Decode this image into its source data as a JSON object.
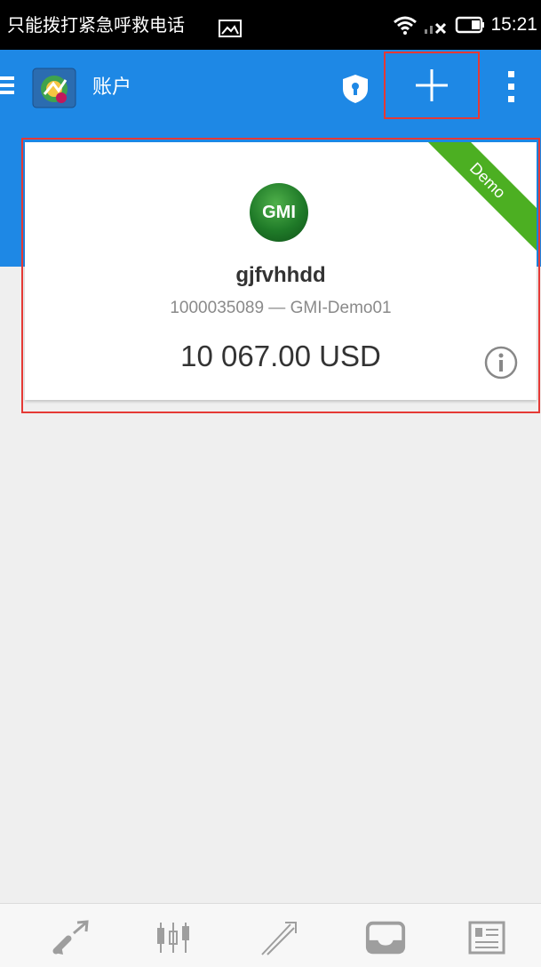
{
  "status_bar": {
    "carrier_text": "只能拨打紧急呼救电话",
    "time": "15:21",
    "icons": [
      "image-icon",
      "wifi-icon",
      "signal-off-icon",
      "battery-icon"
    ]
  },
  "app_bar": {
    "title": "账户",
    "icons": [
      "hamburger-icon",
      "metatrader-app-icon",
      "shield-icon",
      "plus-icon",
      "more-vert-icon"
    ]
  },
  "account_card": {
    "broker_logo_text": "GMI",
    "ribbon_label": "Demo",
    "name": "gjfvhhdd",
    "subtitle": "1000035089 — GMI-Demo01",
    "balance": "10 067.00 USD"
  },
  "bottom_nav": {
    "items": [
      "quotes-icon",
      "charts-icon",
      "trade-icon",
      "history-icon",
      "news-icon"
    ]
  },
  "colors": {
    "primary": "#1e88e5",
    "ribbon": "#4caf22",
    "highlight": "#e53935",
    "background": "#efefef"
  }
}
